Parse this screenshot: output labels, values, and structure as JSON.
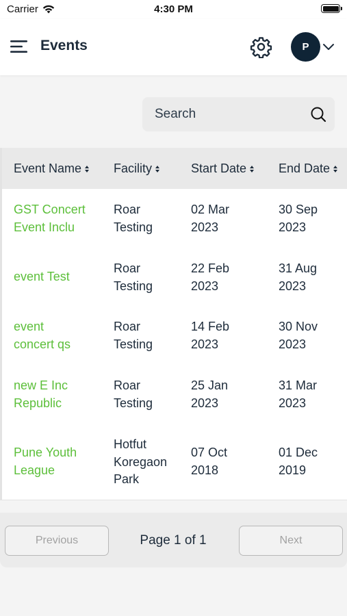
{
  "status_bar": {
    "carrier": "Carrier",
    "time": "4:30 PM"
  },
  "header": {
    "title": "Events",
    "avatar_initial": "P",
    "icons": [
      "menu-icon",
      "gear-icon",
      "chevron-down-icon"
    ]
  },
  "search": {
    "placeholder": "Search",
    "value": ""
  },
  "table": {
    "columns": [
      "Event Name",
      "Facility",
      "Start Date",
      "End Date"
    ],
    "rows": [
      {
        "name": [
          "GST Concert",
          "Event Inclu"
        ],
        "facility": [
          "Roar",
          "Testing"
        ],
        "start": [
          "02 Mar",
          "2023"
        ],
        "end": [
          "30 Sep",
          "2023"
        ]
      },
      {
        "name": [
          "event Test"
        ],
        "facility": [
          "Roar",
          "Testing"
        ],
        "start": [
          "22 Feb",
          "2023"
        ],
        "end": [
          "31 Aug",
          "2023"
        ]
      },
      {
        "name": [
          "event",
          "concert qs"
        ],
        "facility": [
          "Roar",
          "Testing"
        ],
        "start": [
          "14 Feb",
          "2023"
        ],
        "end": [
          "30 Nov",
          "2023"
        ]
      },
      {
        "name": [
          "new E Inc",
          "Republic"
        ],
        "facility": [
          "Roar",
          "Testing"
        ],
        "start": [
          "25 Jan",
          "2023"
        ],
        "end": [
          "31 Mar",
          "2023"
        ]
      },
      {
        "name": [
          "Pune Youth",
          "League"
        ],
        "facility": [
          "Hotfut",
          "Koregaon",
          "Park"
        ],
        "start": [
          "07 Oct",
          "2018"
        ],
        "end": [
          "01 Dec",
          "2019"
        ]
      }
    ]
  },
  "pagination": {
    "previous_label": "Previous",
    "next_label": "Next",
    "page_info": "Page 1 of 1"
  },
  "colors": {
    "accent_green": "#5cbf3a",
    "avatar_bg": "#0f2436",
    "text_primary": "#1d2b3a"
  }
}
